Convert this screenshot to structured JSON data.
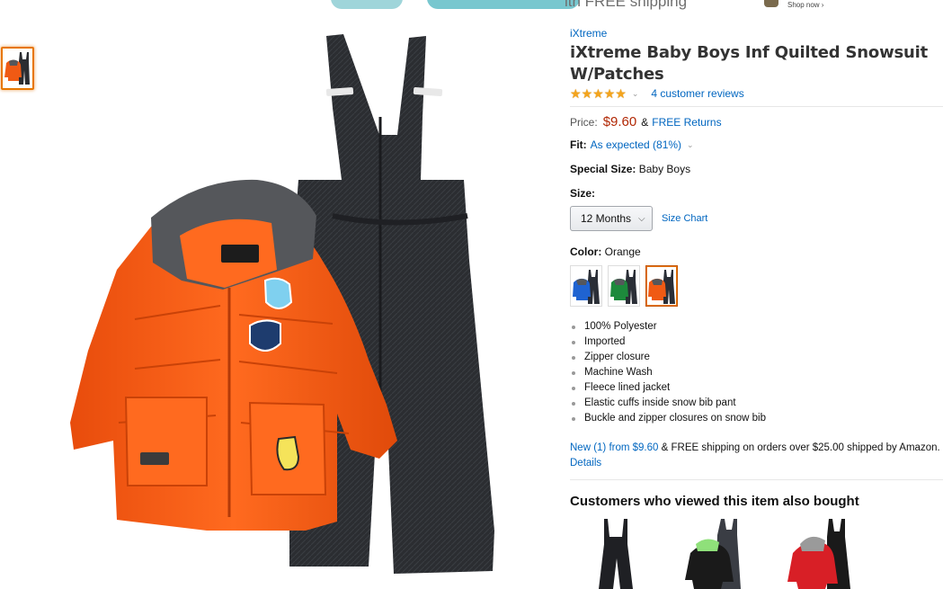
{
  "banner": {
    "text": "ith FREE shipping",
    "shop_now": "Shop now ›"
  },
  "product": {
    "brand": "iXtreme",
    "title": "iXtreme Baby Boys Inf Quilted Snowsuit W/Patches",
    "rating_stars": 5,
    "reviews_text": "4 customer reviews",
    "price_label": "Price:",
    "price": "$9.60",
    "price_amp": "&",
    "free_returns": "FREE Returns",
    "fit_label": "Fit:",
    "fit_value": "As expected (81%)",
    "special_size_label": "Special Size:",
    "special_size_value": "Baby Boys",
    "size_label": "Size:",
    "size_selected": "12 Months",
    "size_chart": "Size Chart",
    "color_label": "Color:",
    "color_value": "Orange",
    "swatches": [
      {
        "name": "Blue",
        "jacket": "#1f63d1",
        "pants": "#2a2e36",
        "selected": false
      },
      {
        "name": "Green",
        "jacket": "#1d8a3c",
        "pants": "#2a2e36",
        "selected": false
      },
      {
        "name": "Orange",
        "jacket": "#f05a14",
        "pants": "#2a2e36",
        "selected": true
      }
    ],
    "features": [
      "100% Polyester",
      "Imported",
      "Zipper closure",
      "Machine Wash",
      "Fleece lined jacket",
      "Elastic cuffs inside snow bib pant",
      "Buckle and zipper closures on snow bib"
    ],
    "offer_new": "New (1) from $9.60",
    "offer_rest": " & FREE shipping on orders over $25.00 shipped by Amazon.",
    "details": "Details"
  },
  "also_bought": {
    "title": "Customers who viewed this item also bought"
  },
  "colors": {
    "link": "#0066c0",
    "price": "#b12704",
    "star": "#f4a41c",
    "selected_border": "#e77600",
    "jacket_orange": "#f05a14",
    "pants_black": "#2b2d31"
  }
}
